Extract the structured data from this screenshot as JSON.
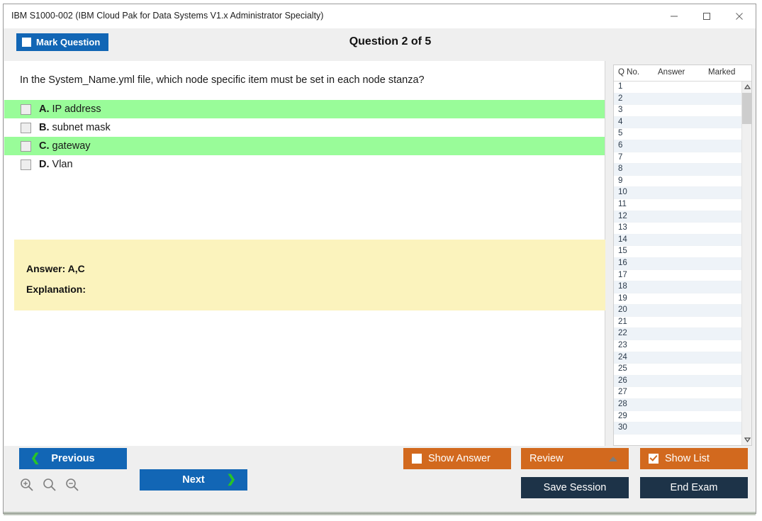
{
  "window": {
    "title": "IBM S1000-002 (IBM Cloud Pak for Data Systems V1.x Administrator Specialty)",
    "minimize_label": "minimize",
    "maximize_label": "maximize",
    "close_label": "close"
  },
  "header": {
    "mark_question_label": "Mark Question",
    "mark_question_checked": false,
    "question_counter": "Question 2 of 5"
  },
  "question": {
    "text": "In the System_Name.yml file, which node specific item must be set in each node stanza?",
    "options": [
      {
        "letter": "A.",
        "text": "IP address",
        "correct": true,
        "checked": false
      },
      {
        "letter": "B.",
        "text": "subnet mask",
        "correct": false,
        "checked": false
      },
      {
        "letter": "C.",
        "text": "gateway",
        "correct": true,
        "checked": false
      },
      {
        "letter": "D.",
        "text": "Vlan",
        "correct": false,
        "checked": false
      }
    ]
  },
  "answer_panel": {
    "answer_label": "Answer: A,C",
    "explanation_label": "Explanation:"
  },
  "question_list": {
    "columns": [
      "Q No.",
      "Answer",
      "Marked"
    ],
    "rows": [
      {
        "q_no": "1",
        "answer": "",
        "marked": ""
      },
      {
        "q_no": "2",
        "answer": "",
        "marked": ""
      },
      {
        "q_no": "3",
        "answer": "",
        "marked": ""
      },
      {
        "q_no": "4",
        "answer": "",
        "marked": ""
      },
      {
        "q_no": "5",
        "answer": "",
        "marked": ""
      },
      {
        "q_no": "6",
        "answer": "",
        "marked": ""
      },
      {
        "q_no": "7",
        "answer": "",
        "marked": ""
      },
      {
        "q_no": "8",
        "answer": "",
        "marked": ""
      },
      {
        "q_no": "9",
        "answer": "",
        "marked": ""
      },
      {
        "q_no": "10",
        "answer": "",
        "marked": ""
      },
      {
        "q_no": "11",
        "answer": "",
        "marked": ""
      },
      {
        "q_no": "12",
        "answer": "",
        "marked": ""
      },
      {
        "q_no": "13",
        "answer": "",
        "marked": ""
      },
      {
        "q_no": "14",
        "answer": "",
        "marked": ""
      },
      {
        "q_no": "15",
        "answer": "",
        "marked": ""
      },
      {
        "q_no": "16",
        "answer": "",
        "marked": ""
      },
      {
        "q_no": "17",
        "answer": "",
        "marked": ""
      },
      {
        "q_no": "18",
        "answer": "",
        "marked": ""
      },
      {
        "q_no": "19",
        "answer": "",
        "marked": ""
      },
      {
        "q_no": "20",
        "answer": "",
        "marked": ""
      },
      {
        "q_no": "21",
        "answer": "",
        "marked": ""
      },
      {
        "q_no": "22",
        "answer": "",
        "marked": ""
      },
      {
        "q_no": "23",
        "answer": "",
        "marked": ""
      },
      {
        "q_no": "24",
        "answer": "",
        "marked": ""
      },
      {
        "q_no": "25",
        "answer": "",
        "marked": ""
      },
      {
        "q_no": "26",
        "answer": "",
        "marked": ""
      },
      {
        "q_no": "27",
        "answer": "",
        "marked": ""
      },
      {
        "q_no": "28",
        "answer": "",
        "marked": ""
      },
      {
        "q_no": "29",
        "answer": "",
        "marked": ""
      },
      {
        "q_no": "30",
        "answer": "",
        "marked": ""
      }
    ]
  },
  "footer": {
    "previous_label": "Previous",
    "next_label": "Next",
    "show_answer_label": "Show Answer",
    "show_answer_checked": false,
    "review_label": "Review",
    "show_list_label": "Show List",
    "show_list_checked": true,
    "save_session_label": "Save Session",
    "end_exam_label": "End Exam",
    "zoom_in_label": "zoom-in",
    "zoom_reset_label": "zoom-reset",
    "zoom_out_label": "zoom-out"
  },
  "colors": {
    "accent_blue": "#1266b5",
    "accent_orange": "#d2691e",
    "dark_navy": "#1d3348",
    "correct_green": "#99fc99",
    "answer_yellow": "#fbf3bd",
    "chrome_gray": "#efefef"
  }
}
